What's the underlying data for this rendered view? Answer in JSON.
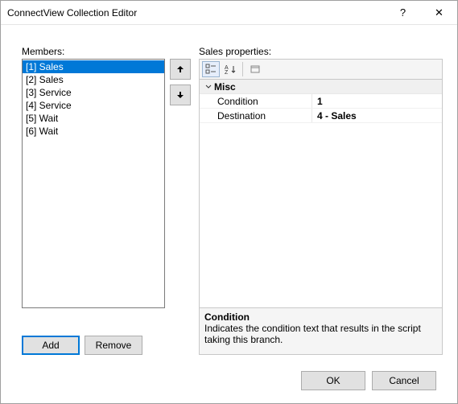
{
  "window": {
    "title": "ConnectView Collection Editor",
    "help_glyph": "?",
    "close_glyph": "✕"
  },
  "members": {
    "label": "Members:",
    "items": [
      {
        "text": "[1] Sales",
        "selected": true
      },
      {
        "text": "[2] Sales",
        "selected": false
      },
      {
        "text": "[3] Service",
        "selected": false
      },
      {
        "text": "[4] Service",
        "selected": false
      },
      {
        "text": "[5] Wait",
        "selected": false
      },
      {
        "text": "[6] Wait",
        "selected": false
      }
    ]
  },
  "buttons": {
    "add": "Add",
    "remove": "Remove",
    "ok": "OK",
    "cancel": "Cancel"
  },
  "properties": {
    "header_label": "Sales properties:",
    "category": "Misc",
    "rows": [
      {
        "name": "Condition",
        "value": "1"
      },
      {
        "name": "Destination",
        "value": "4 - Sales"
      }
    ],
    "description": {
      "title": "Condition",
      "text": "Indicates the condition text that results in the script taking this branch."
    }
  }
}
